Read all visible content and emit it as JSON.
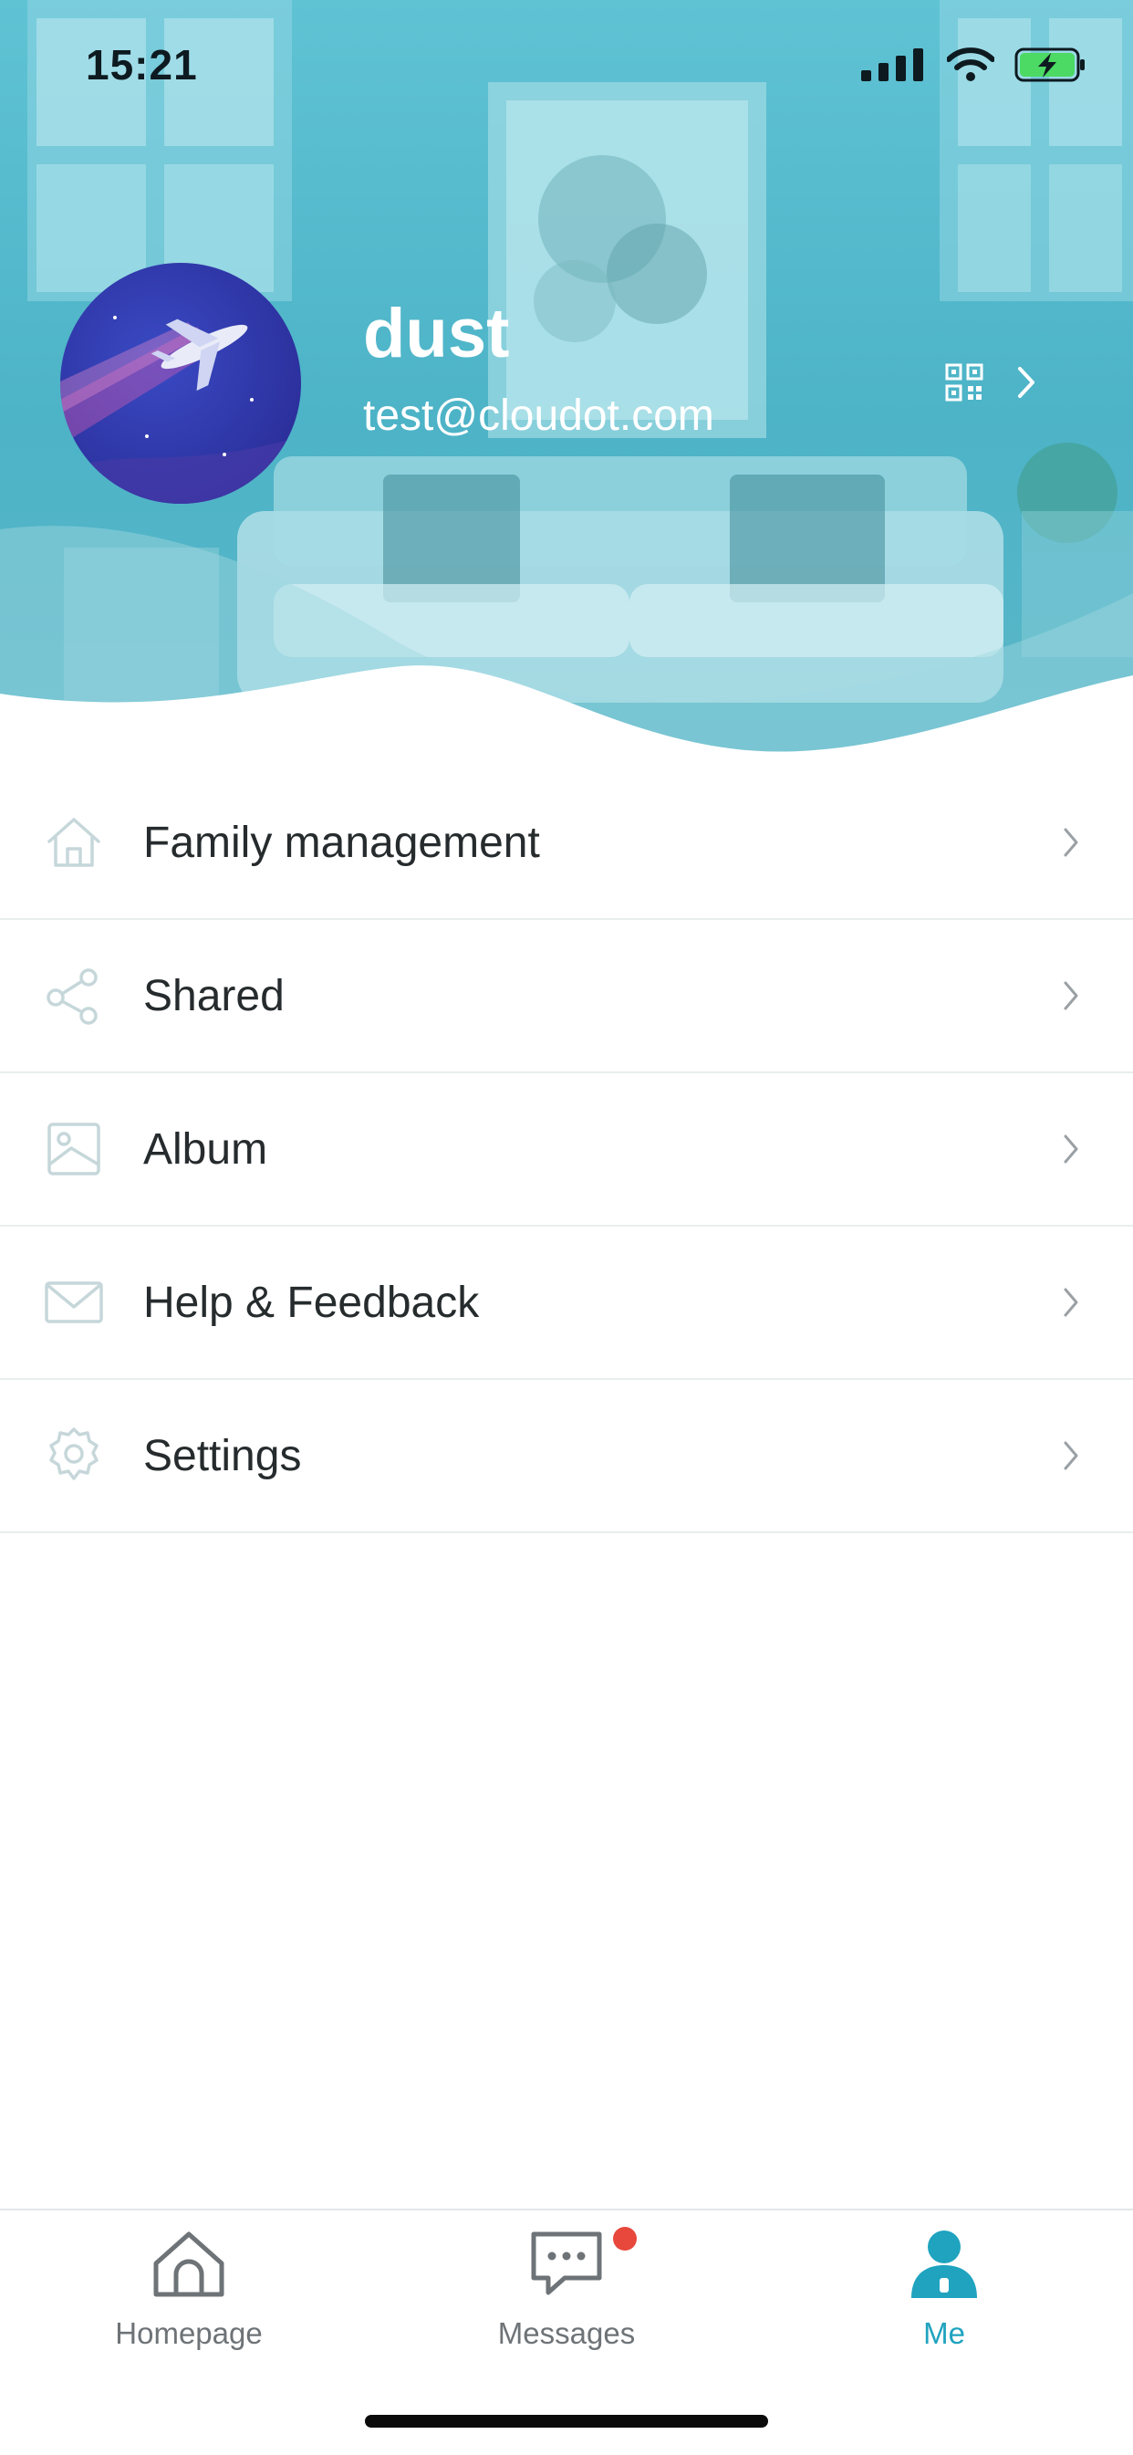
{
  "status_bar": {
    "time": "15:21",
    "icons": [
      "signal-icon",
      "wifi-icon",
      "battery-charging-icon"
    ]
  },
  "profile": {
    "username": "dust",
    "email": "test@cloudot.com",
    "avatar": "airplane-avatar",
    "qr_icon": "qr-code-icon"
  },
  "menu": {
    "items": [
      {
        "label": "Family management",
        "icon": "home-outline-icon"
      },
      {
        "label": "Shared",
        "icon": "share-icon"
      },
      {
        "label": "Album",
        "icon": "image-icon"
      },
      {
        "label": "Help & Feedback",
        "icon": "mail-icon"
      },
      {
        "label": "Settings",
        "icon": "gear-icon"
      }
    ]
  },
  "tabbar": {
    "tabs": [
      {
        "label": "Homepage",
        "icon": "home-icon",
        "active": false
      },
      {
        "label": "Messages",
        "icon": "chat-bubble-icon",
        "active": false,
        "has_badge": true
      },
      {
        "label": "Me",
        "icon": "person-icon",
        "active": true
      }
    ]
  },
  "colors": {
    "header_tint": "#4db3c7",
    "accent": "#1fa3bf",
    "badge": "#e8473b",
    "avatar_bg": "#3136a8",
    "menu_icon": "#c6d7da",
    "chevron": "#9aa0a4"
  }
}
